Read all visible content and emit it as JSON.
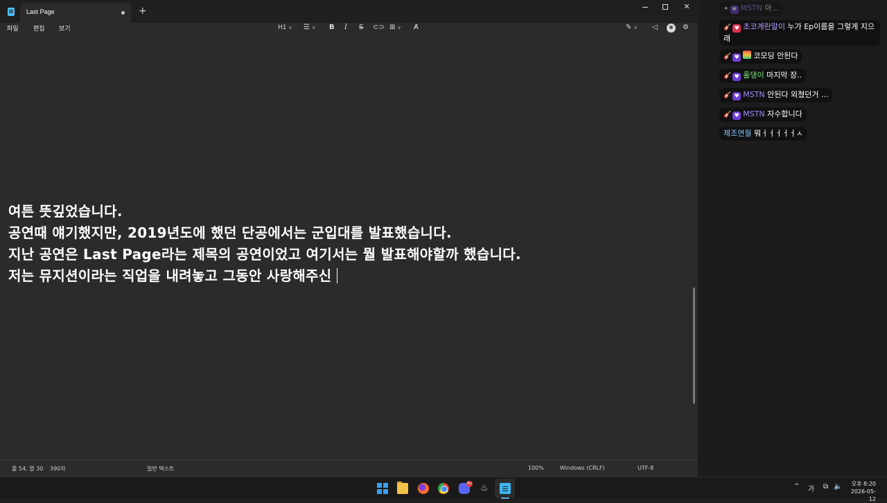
{
  "window": {
    "tab_title": "Last Page",
    "new_tab": "+",
    "min": "",
    "max": "",
    "close": "✕"
  },
  "menu": [
    "파일",
    "편집",
    "보기"
  ],
  "toolbar": {
    "heading": "H1",
    "list_icon": "list-icon",
    "bold": "B",
    "italic": "I",
    "strike": "S",
    "link_icon": "link-icon",
    "table_icon": "table-icon",
    "clear_icon": "clear-format-icon"
  },
  "document": {
    "lines": [
      "여튼 뜻깊었습니다.",
      "공연때 얘기했지만, 2019년도에 했던 단공에서는 군입대를 발표했습니다.",
      "지난 공연은 Last Page라는 제목의 공연이었고 여기서는 뭘 발표해야할까 했습니다.",
      "저는 뮤지션이라는 직업을 내려놓고 그동안 사랑해주신"
    ]
  },
  "status": {
    "position": "줄 54, 열 30",
    "char_count": "390자",
    "format": "일반 텍스트",
    "zoom": "100%",
    "line_ending": "Windows (CRLF)",
    "encoding": "UTF-8"
  },
  "chat": [
    {
      "nick": "MSTN",
      "text": "아...",
      "nick_color": "#9a8cff",
      "badge": "heart",
      "faded": true
    },
    {
      "nick": "초코계란말이",
      "text": "누가 Ep이름을 그렇게 지으래",
      "nick_color": "#b79cff",
      "badge": "heart-red"
    },
    {
      "nick": "코모딩",
      "text": "안된다",
      "nick_color": "#ffffff",
      "badge": "rainbow"
    },
    {
      "nick": "홀댕이",
      "text": "마지막 장..",
      "nick_color": "#7fe07a",
      "badge": "heart"
    },
    {
      "nick": "MSTN",
      "text": "안된다 외쳤던거 ...",
      "nick_color": "#9a8cff",
      "badge": "heart"
    },
    {
      "nick": "MSTN",
      "text": "자수합니다",
      "nick_color": "#9a8cff",
      "badge": "heart"
    },
    {
      "nick": "제조연월",
      "text": "뭐ㅓㅓㅓㅓㅓㅅ",
      "nick_color": "#7fc8ff",
      "badge": "none"
    }
  ],
  "taskbar": {
    "discord_badge": "9+",
    "tray_up": "^",
    "ime": "가",
    "time_line1": "오후 8:20",
    "time_line2": "2026-05-12"
  }
}
